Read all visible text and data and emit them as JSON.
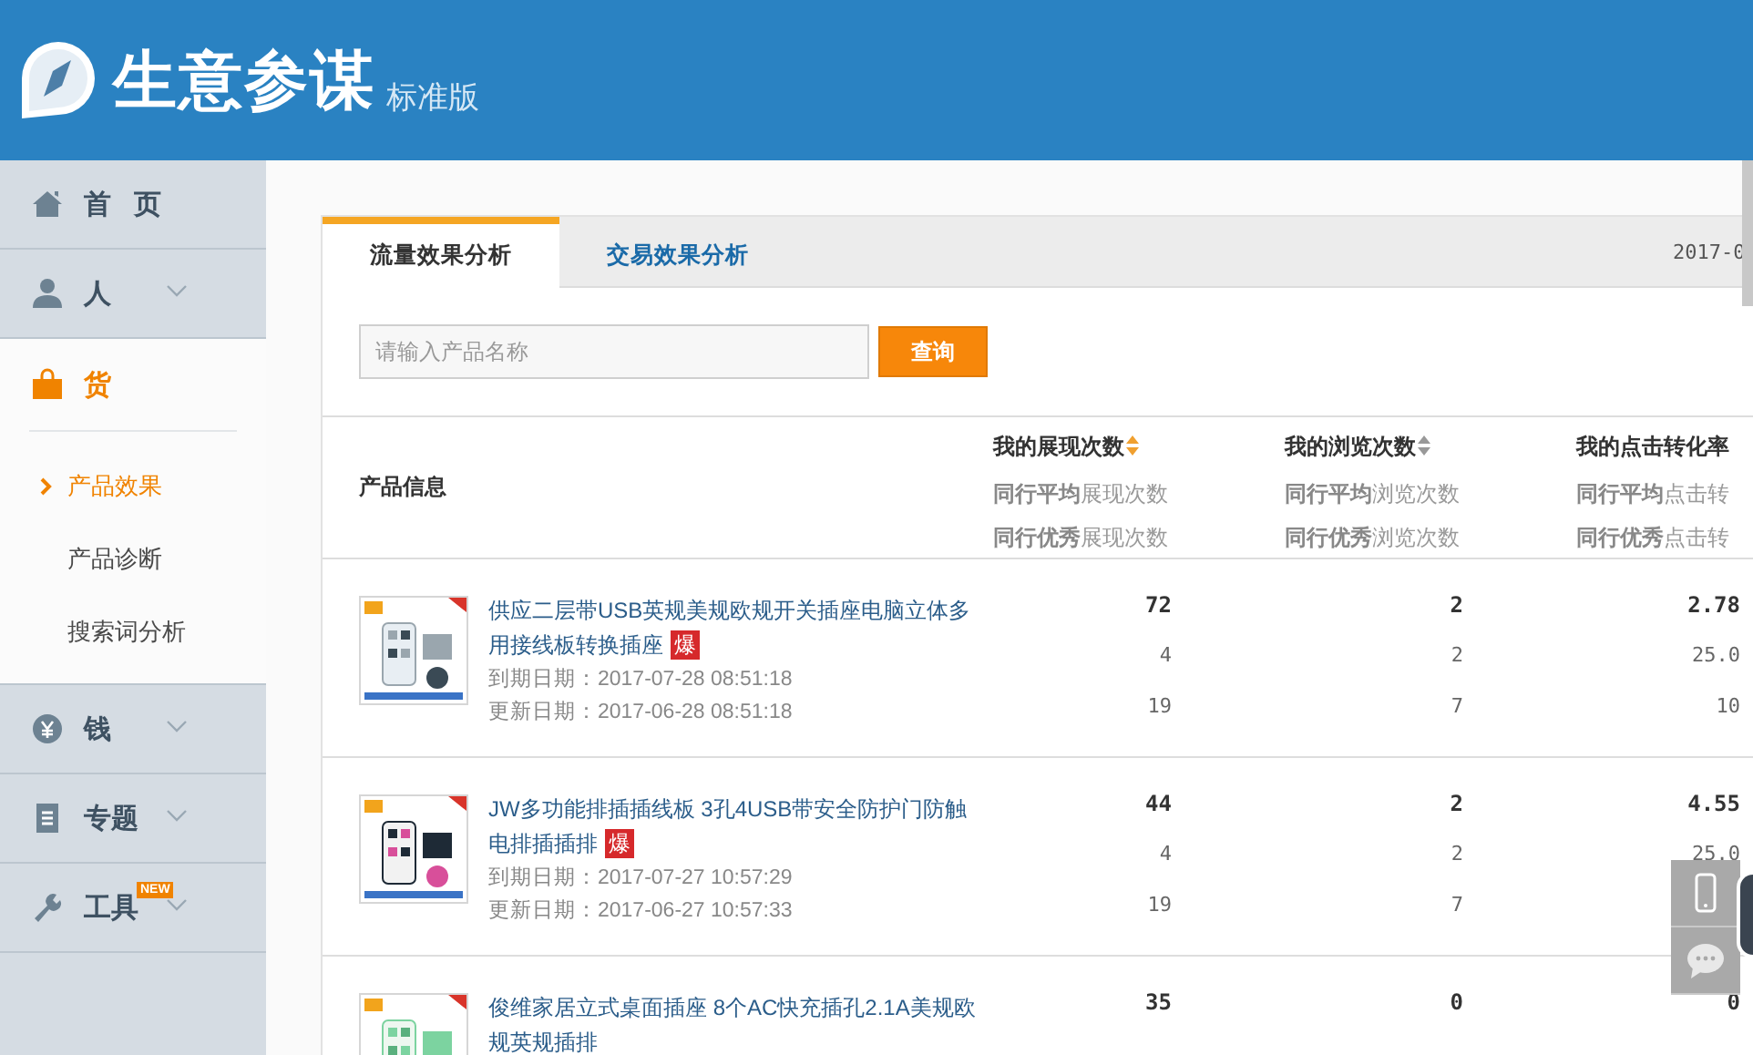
{
  "header": {
    "title": "生意参谋",
    "edition": "标准版"
  },
  "sidebar": {
    "items": [
      {
        "label": "首 页",
        "kind": "home",
        "expandable": false,
        "selected": false
      },
      {
        "label": "人",
        "kind": "person",
        "expandable": true,
        "selected": false
      },
      {
        "label": "货",
        "kind": "bag",
        "expandable": false,
        "selected": true,
        "children": [
          {
            "label": "产品效果",
            "selected": true
          },
          {
            "label": "产品诊断",
            "selected": false
          },
          {
            "label": "搜索词分析",
            "selected": false
          }
        ]
      },
      {
        "label": "钱",
        "kind": "yen",
        "expandable": true,
        "selected": false
      },
      {
        "label": "专题",
        "kind": "list",
        "expandable": true,
        "selected": false
      },
      {
        "label": "工具",
        "kind": "wrench",
        "expandable": true,
        "selected": false,
        "badge": "NEW"
      }
    ]
  },
  "tabs": [
    {
      "label": "流量效果分析",
      "selected": true
    },
    {
      "label": "交易效果分析",
      "selected": false
    }
  ],
  "date": "2017-0",
  "search": {
    "placeholder": "请输入产品名称",
    "button": "查询"
  },
  "table": {
    "product_column": "产品信息",
    "columns": [
      {
        "title": "我的展现次数",
        "sortable": true,
        "sort_active": true,
        "lines": [
          "**同行平均**展现次数",
          "**同行优秀**展现次数"
        ]
      },
      {
        "title": "我的浏览次数",
        "sortable": true,
        "sort_active": false,
        "lines": [
          "**同行平均**浏览次数",
          "**同行优秀**浏览次数"
        ]
      },
      {
        "title": "我的点击转化率",
        "sortable": false,
        "lines": [
          "**同行平均**点击转",
          "**同行优秀**点击转"
        ]
      }
    ],
    "rows": [
      {
        "title": "供应二层带USB英规美规欧规开关插座电脑立体多用接线板转换插座",
        "badge": "爆",
        "expiry": "到期日期：2017-07-28 08:51:18",
        "updated": "更新日期：2017-06-28 08:51:18",
        "values": [
          [
            "72",
            "4",
            "19"
          ],
          [
            "2",
            "2",
            "7"
          ],
          [
            "2.78",
            "25.0",
            "10"
          ]
        ]
      },
      {
        "title": "JW多功能排插插线板 3孔4USB带安全防护门防触电排插插排",
        "badge": "爆",
        "expiry": "到期日期：2017-07-27 10:57:29",
        "updated": "更新日期：2017-06-27 10:57:33",
        "values": [
          [
            "44",
            "4",
            "19"
          ],
          [
            "2",
            "2",
            "7"
          ],
          [
            "4.55",
            "25.0"
          ]
        ]
      },
      {
        "title": "俊维家居立式桌面插座 8个AC快充插孔2.1A美规欧规英规插排",
        "values": [
          [
            "35"
          ],
          [
            "0"
          ],
          [
            "0"
          ]
        ]
      }
    ]
  },
  "float_buttons": [
    {
      "kind": "phone"
    },
    {
      "kind": "chat"
    }
  ]
}
